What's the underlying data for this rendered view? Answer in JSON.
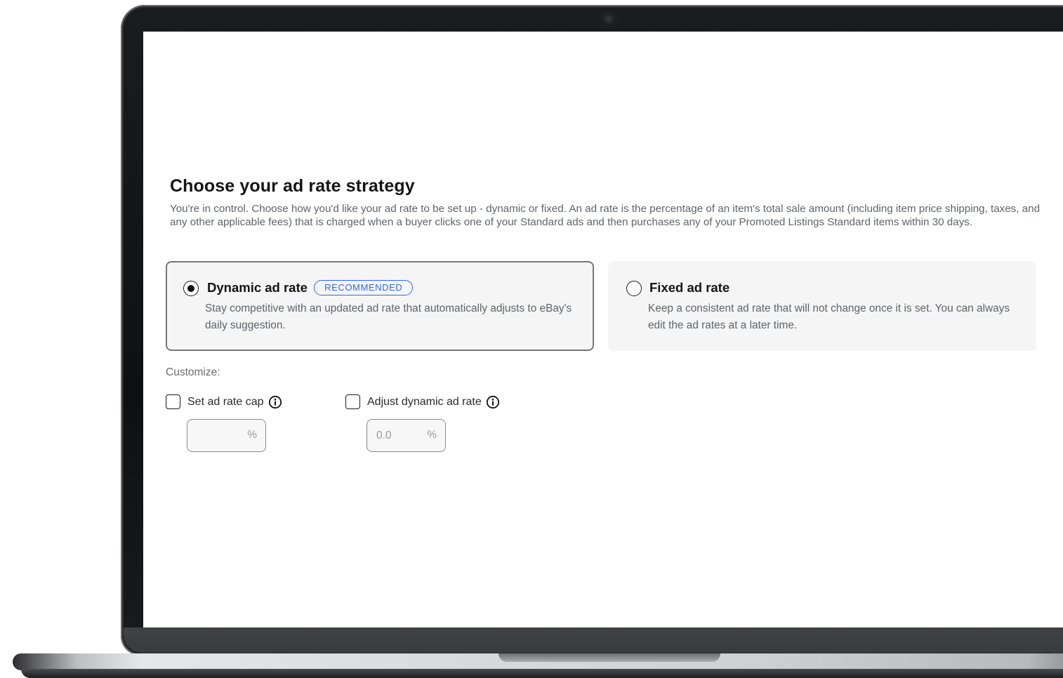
{
  "page": {
    "heading": "Choose your ad rate strategy",
    "description": "You're in control. Choose how you'd like your ad rate to be set up - dynamic or fixed. An ad rate is the percentage of an item's total sale amount (including item price shipping, taxes, and any other applicable fees) that is charged when a buyer clicks one of your Standard ads and then purchases any of your Promoted Listings Standard items within 30 days."
  },
  "strategy_options": [
    {
      "title": "Dynamic ad rate",
      "badge": "RECOMMENDED",
      "description": "Stay competitive with an updated ad rate that automatically adjusts to eBay's daily suggestion.",
      "selected": true
    },
    {
      "title": "Fixed ad rate",
      "description": "Keep a consistent ad rate that will not change once it is set. You can always edit the ad rates at a later time.",
      "selected": false
    }
  ],
  "customize": {
    "label": "Customize:",
    "ad_rate_cap": {
      "label": "Set ad rate cap",
      "checked": false,
      "value": "",
      "unit": "%"
    },
    "adjust_dynamic": {
      "label": "Adjust dynamic ad rate",
      "checked": false,
      "placeholder": "0.0",
      "unit": "%"
    }
  },
  "colors": {
    "badge_blue": "#3665f3",
    "heading_text": "#151515",
    "body_text": "#5f6368",
    "card_background": "#f5f5f5"
  },
  "icons": {
    "info": "info-circle-icon"
  }
}
